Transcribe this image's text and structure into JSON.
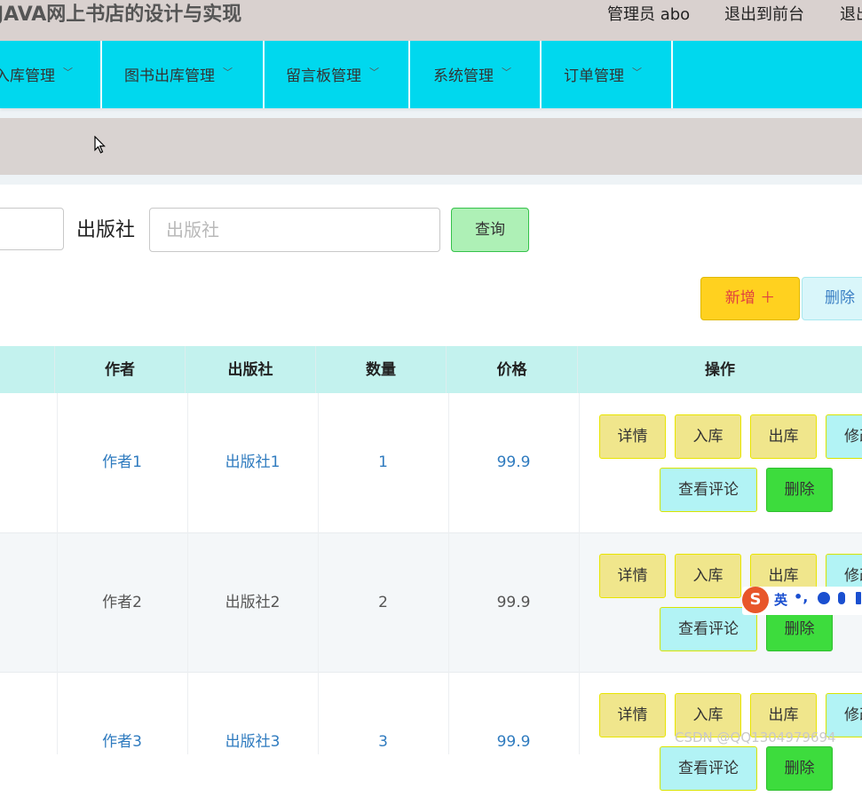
{
  "header": {
    "title": "JAVA网上书店的设计与实现",
    "user": "管理员 abo",
    "back_to_front": "退出到前台",
    "logout": "退出"
  },
  "nav": {
    "items": [
      {
        "label": "入库管理"
      },
      {
        "label": "图书出库管理"
      },
      {
        "label": "留言板管理"
      },
      {
        "label": "系统管理"
      },
      {
        "label": "订单管理"
      }
    ]
  },
  "search": {
    "publisher_label": "出版社",
    "publisher_placeholder": "出版社",
    "publisher_value": "",
    "query_button": "查询"
  },
  "actions": {
    "add_button": "新增 ＋",
    "delete_button": "删除"
  },
  "table": {
    "columns": [
      "作者",
      "出版社",
      "数量",
      "价格",
      "操作"
    ],
    "rows": [
      {
        "author": "作者1",
        "publisher": "出版社1",
        "quantity": "1",
        "price": "99.9"
      },
      {
        "author": "作者2",
        "publisher": "出版社2",
        "quantity": "2",
        "price": "99.9"
      },
      {
        "author": "作者3",
        "publisher": "出版社3",
        "quantity": "3",
        "price": "99.9"
      }
    ],
    "row_buttons": {
      "detail": "详情",
      "stock_in": "入库",
      "stock_out": "出库",
      "edit": "修改",
      "view_comments": "查看评论",
      "delete": "删除"
    }
  },
  "ime": {
    "logo": "S",
    "mode": "英"
  },
  "watermark": "CSDN @QQ1304979694",
  "colors": {
    "nav": "#00d8ee",
    "header": "#d9d1cf",
    "table_head": "#c3f2ee",
    "add_button": "#ffd11f",
    "query_button": "#aef0b6"
  }
}
